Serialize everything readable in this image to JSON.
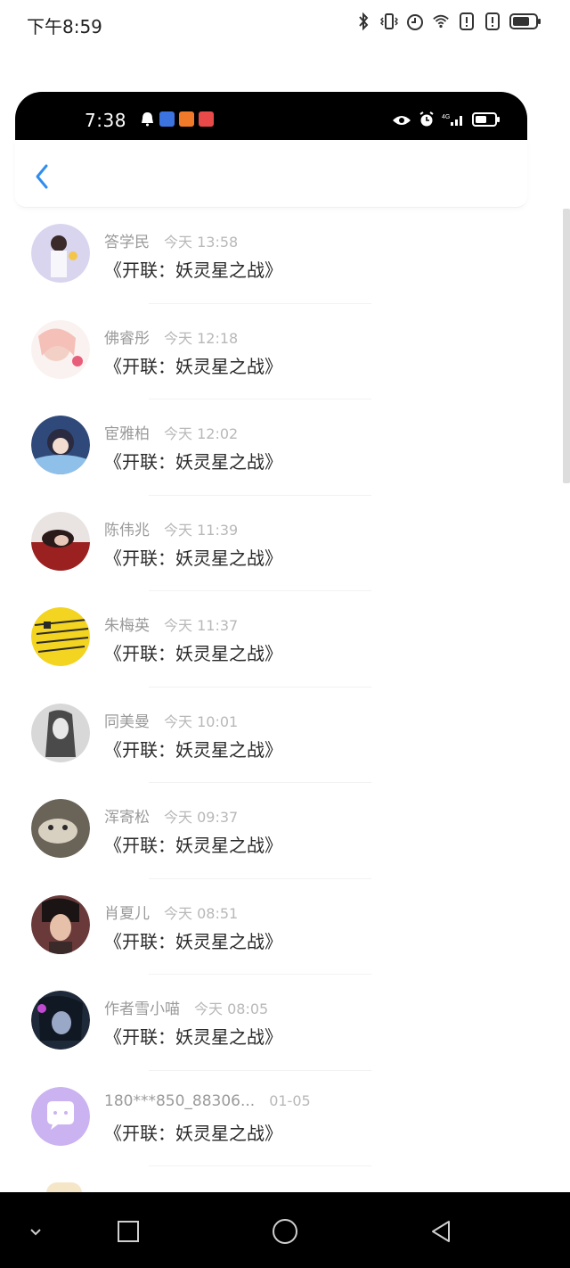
{
  "outer_status": {
    "time": "下午8:59",
    "icons": [
      "bluetooth-icon",
      "vibrate-icon",
      "alarm-icon",
      "wifi-icon",
      "alert-icon",
      "alert-icon",
      "battery-icon"
    ]
  },
  "inner_status": {
    "time": "7:38",
    "left_icons": [
      "notification-icon",
      "app-icon",
      "app-icon",
      "app-icon"
    ],
    "right_icons": [
      "eye-icon",
      "alarm-icon",
      "signal-icon",
      "battery-icon"
    ],
    "network": "4G"
  },
  "nav": {
    "back_icon": "chevron-left-icon"
  },
  "list": [
    {
      "name": "答学民",
      "time": "今天 13:58",
      "message": "《开联：妖灵星之战》",
      "avatar_color": "#d9d5ef"
    },
    {
      "name": "佛睿彤",
      "time": "今天 12:18",
      "message": "《开联：妖灵星之战》",
      "avatar_color": "#f6d9d4"
    },
    {
      "name": "宦雅柏",
      "time": "今天 12:02",
      "message": "《开联：妖灵星之战》",
      "avatar_color": "#2f4a7a"
    },
    {
      "name": "陈伟兆",
      "time": "今天 11:39",
      "message": "《开联：妖灵星之战》",
      "avatar_color": "#8a2a2a"
    },
    {
      "name": "朱梅英",
      "time": "今天 11:37",
      "message": "《开联：妖灵星之战》",
      "avatar_color": "#f2d21e"
    },
    {
      "name": "同美曼",
      "time": "今天 10:01",
      "message": "《开联：妖灵星之战》",
      "avatar_color": "#9a9a9a"
    },
    {
      "name": "浑寄松",
      "time": "今天 09:37",
      "message": "《开联：妖灵星之战》",
      "avatar_color": "#8c8473"
    },
    {
      "name": "肖夏儿",
      "time": "今天 08:51",
      "message": "《开联：妖灵星之战》",
      "avatar_color": "#4a3030"
    },
    {
      "name": "作者雪小喵",
      "time": "今天 08:05",
      "message": "《开联：妖灵星之战》",
      "avatar_color": "#1e2a3a"
    },
    {
      "name": "180***850_88306...",
      "time": "01-05",
      "message": "《开联：妖灵星之战》",
      "avatar_color": "#c9b4f0"
    }
  ],
  "bottom_nav": {
    "icons": [
      "chevron-down-icon",
      "square-icon",
      "circle-icon",
      "triangle-back-icon"
    ]
  }
}
